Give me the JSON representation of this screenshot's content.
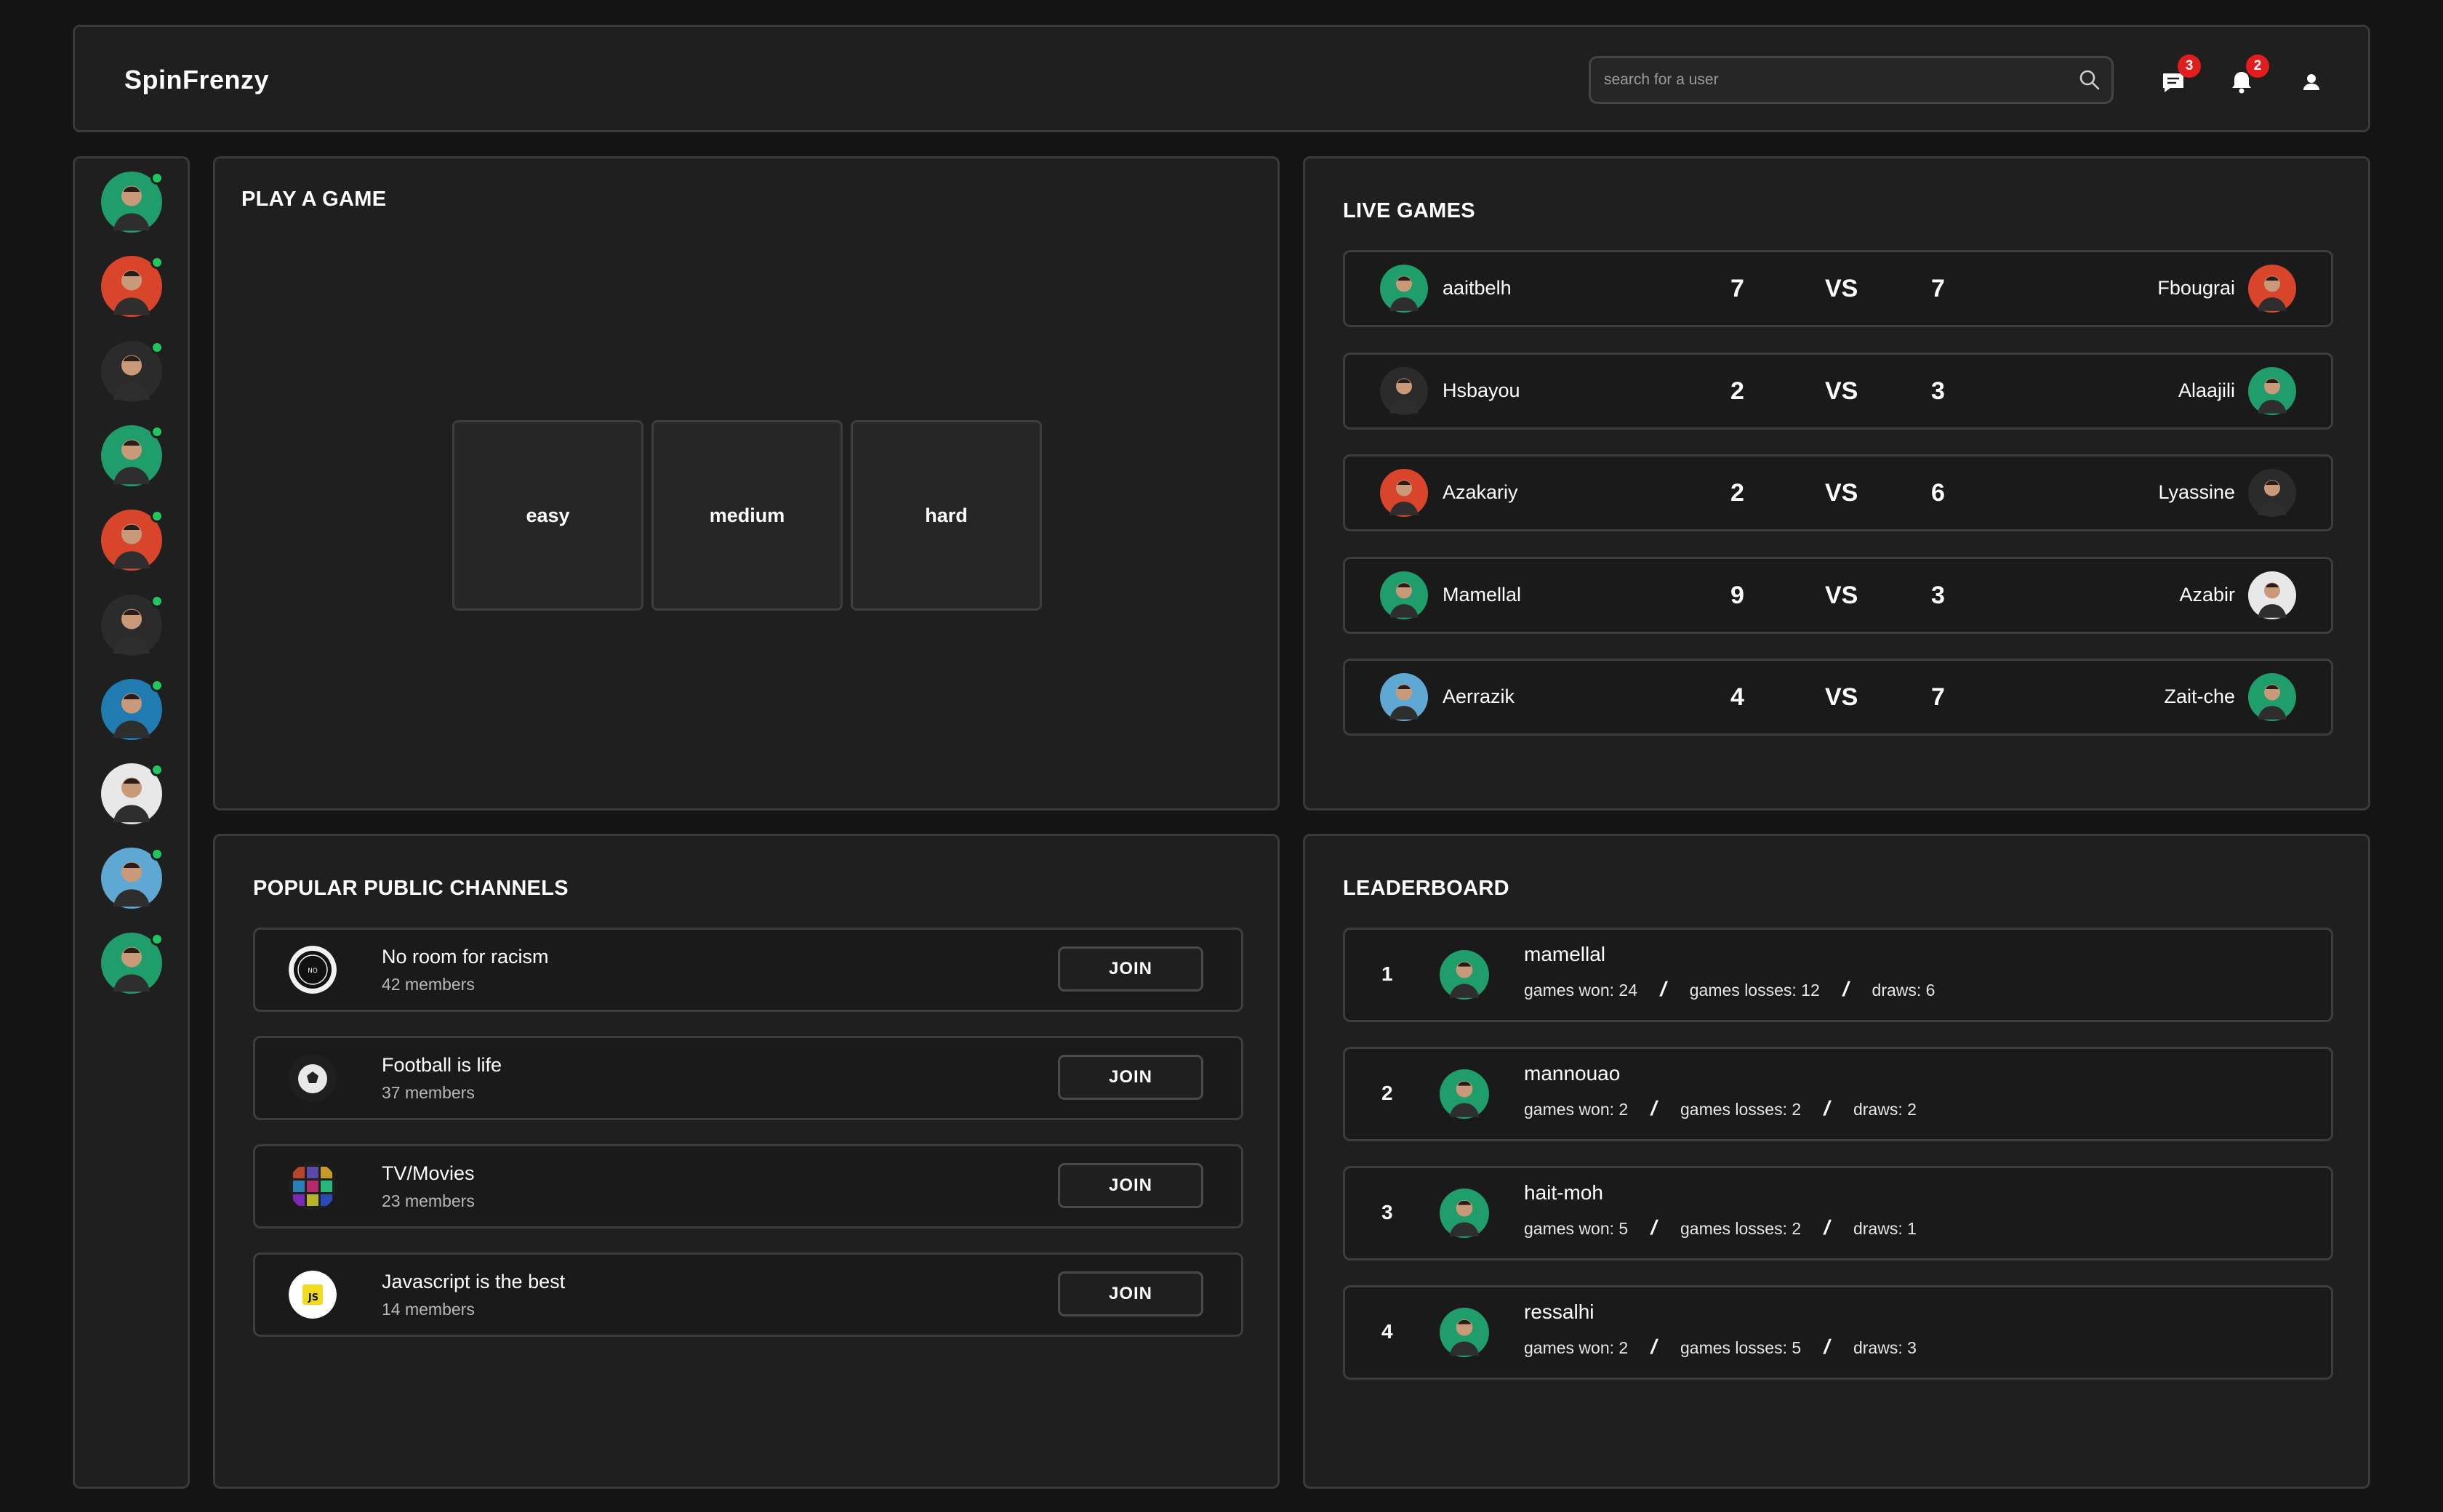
{
  "app": {
    "title": "SpinFrenzy"
  },
  "header": {
    "search_placeholder": "search for a user",
    "messages_badge": "3",
    "notifications_badge": "2"
  },
  "sidebar": {
    "friends": [
      {
        "online": true,
        "color": "#1f9d6b"
      },
      {
        "online": true,
        "color": "#d9452b"
      },
      {
        "online": true,
        "color": "#2b2b2b"
      },
      {
        "online": true,
        "color": "#1f9d6b"
      },
      {
        "online": true,
        "color": "#d9452b"
      },
      {
        "online": true,
        "color": "#2b2b2b"
      },
      {
        "online": true,
        "color": "#1f7bb0"
      },
      {
        "online": true,
        "color": "#e8e8e8"
      },
      {
        "online": true,
        "color": "#5fa8d3"
      },
      {
        "online": true,
        "color": "#1f9d6b"
      }
    ]
  },
  "play": {
    "title": "PLAY A GAME",
    "levels": [
      "easy",
      "medium",
      "hard"
    ]
  },
  "live": {
    "title": "LIVE GAMES",
    "vs_label": "VS",
    "games": [
      {
        "left": "aaitbelh",
        "left_score": "7",
        "right_score": "7",
        "right": "Fbougrai",
        "left_color": "#1f9d6b",
        "right_color": "#d9452b"
      },
      {
        "left": "Hsbayou",
        "left_score": "2",
        "right_score": "3",
        "right": "Alaajili",
        "left_color": "#2b2b2b",
        "right_color": "#1f9d6b"
      },
      {
        "left": "Azakariy",
        "left_score": "2",
        "right_score": "6",
        "right": "Lyassine",
        "left_color": "#d9452b",
        "right_color": "#2b2b2b"
      },
      {
        "left": "Mamellal",
        "left_score": "9",
        "right_score": "3",
        "right": "Azabir",
        "left_color": "#1f9d6b",
        "right_color": "#e8e8e8"
      },
      {
        "left": "Aerrazik",
        "left_score": "4",
        "right_score": "7",
        "right": "Zait-che",
        "left_color": "#5fa8d3",
        "right_color": "#1f9d6b"
      }
    ]
  },
  "channels": {
    "title": "POPULAR PUBLIC CHANNELS",
    "join_label": "JOIN",
    "items": [
      {
        "name": "No room for racism",
        "members": "42 members",
        "icon": "no-racism-icon"
      },
      {
        "name": "Football is life",
        "members": "37 members",
        "icon": "football-icon"
      },
      {
        "name": "TV/Movies",
        "members": "23 members",
        "icon": "tv-movies-icon"
      },
      {
        "name": "Javascript is the best",
        "members": "14 members",
        "icon": "javascript-icon",
        "icon_text": "JS"
      }
    ]
  },
  "leaderboard": {
    "title": "LEADERBOARD",
    "rows": [
      {
        "rank": "1",
        "name": "mamellal",
        "won": "games won: 24",
        "losses": "games losses: 12",
        "draws": "draws: 6",
        "color": "#1f9d6b"
      },
      {
        "rank": "2",
        "name": "mannouao",
        "won": "games won: 2",
        "losses": "games losses: 2",
        "draws": "draws: 2",
        "color": "#1f9d6b"
      },
      {
        "rank": "3",
        "name": "hait-moh",
        "won": "games won: 5",
        "losses": "games losses: 2",
        "draws": "draws: 1",
        "color": "#1f9d6b"
      },
      {
        "rank": "4",
        "name": "ressalhi",
        "won": "games won: 2",
        "losses": "games losses: 5",
        "draws": "draws: 3",
        "color": "#1f9d6b"
      }
    ],
    "separator": "/"
  }
}
